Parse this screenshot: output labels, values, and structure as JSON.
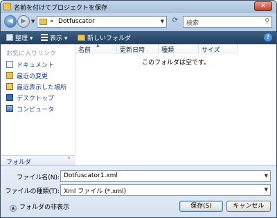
{
  "window": {
    "title": "名前を付けてプロジェクトを保存",
    "close_glyph": "✕"
  },
  "address": {
    "chevron": "«",
    "path": "Dotfuscator",
    "search_placeholder": "検索",
    "back_glyph": "◀",
    "forward_glyph": "▶",
    "dropdown_glyph": "▼",
    "refresh_glyph": "⟳",
    "search_icon_glyph": "⚲"
  },
  "toolbar": {
    "organize_label": "整理 ▾",
    "view_label": "表示 ▾",
    "new_folder_label": "新しいフォルダ",
    "help_glyph": "?"
  },
  "nav": {
    "heading": "お気に入りリンク",
    "links": [
      {
        "label": "ドキュメント",
        "icon": "documents-icon"
      },
      {
        "label": "最近の変更",
        "icon": "recent-changes-icon"
      },
      {
        "label": "最近表示した場所",
        "icon": "recent-places-icon"
      },
      {
        "label": "デスクトップ",
        "icon": "desktop-icon"
      },
      {
        "label": "コンピュータ",
        "icon": "computer-icon"
      }
    ],
    "folders_label": "フォルダ",
    "folders_chevron": "⌃"
  },
  "filelist": {
    "columns": [
      "名前",
      "更新日時",
      "種類",
      "サイズ"
    ],
    "sort_caret": "▲",
    "empty_message": "このフォルダは空です。"
  },
  "form": {
    "filename_label": "ファイル名(N):",
    "filename_value": "Dotfuscator1.xml",
    "filetype_label": "ファイルの種類(T):",
    "filetype_value": "Xml ファイル (*.xml)",
    "hide_folders_label": "フォルダの非表示",
    "hide_chevron": "▲",
    "save_button": "保存(S)",
    "cancel_button": "キャンセル"
  }
}
